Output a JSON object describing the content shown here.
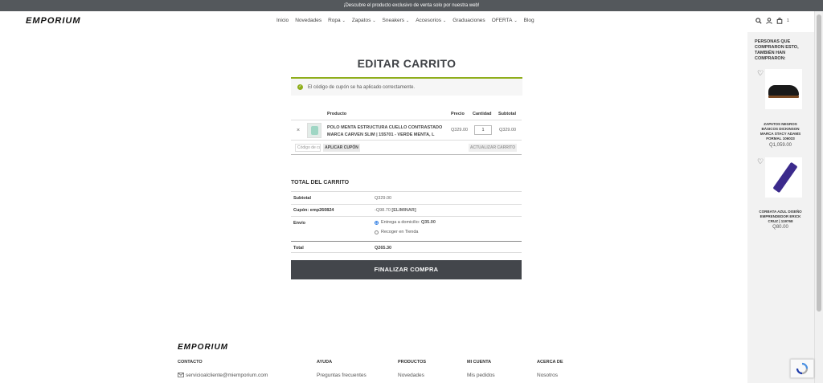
{
  "topbar": {
    "text": "¡Descubre el producto exclusivo de venta solo por nuestra web!"
  },
  "brand": {
    "logo": "EMPORIUM",
    "accent": "#8fae1b",
    "dark": "#43464b"
  },
  "nav": {
    "items": [
      {
        "label": "Inicio",
        "dropdown": false
      },
      {
        "label": "Novedades",
        "dropdown": false
      },
      {
        "label": "Ropa",
        "dropdown": true
      },
      {
        "label": "Zapatos",
        "dropdown": true
      },
      {
        "label": "Sneakers",
        "dropdown": true
      },
      {
        "label": "Accesorios",
        "dropdown": true
      },
      {
        "label": "Graduaciones",
        "dropdown": false
      },
      {
        "label": "OFERTA",
        "dropdown": true
      },
      {
        "label": "Blog",
        "dropdown": false
      }
    ],
    "cart_count": "1"
  },
  "page": {
    "title": "EDITAR CARRITO"
  },
  "notice": {
    "text": "El código de cupón se ha aplicado correctamente."
  },
  "cart": {
    "headers": {
      "product": "Producto",
      "price": "Precio",
      "qty": "Cantidad",
      "subtotal": "Subtotal"
    },
    "items": [
      {
        "remove": "×",
        "name": "POLO MENTA ESTRUCTURA CUELLO CONTRASTADO MARCA CARVEN SLIM | 155701 - VERDE MENTA, L",
        "price": "Q329.00",
        "qty": "1",
        "subtotal": "Q329.00"
      }
    ],
    "coupon_placeholder": "Código de cupón",
    "apply_label": "APLICAR CUPÓN",
    "update_label": "ACTUALIZAR CARRITO"
  },
  "totals": {
    "title": "TOTAL DEL CARRITO",
    "subtotal_label": "Subtotal",
    "subtotal_value": "Q329.00",
    "coupon_label": "Cupón: emp260824",
    "coupon_value": "-Q98.70",
    "coupon_remove": "[ELIMINAR]",
    "shipping_label": "Envío",
    "shipping_options": [
      {
        "label": "Entrega a domicilio:",
        "price": "Q35.00",
        "selected": true
      },
      {
        "label": "Recoger en Tienda",
        "price": "",
        "selected": false
      }
    ],
    "total_label": "Total",
    "total_value": "Q265.30",
    "checkout_label": "FINALIZAR COMPRA"
  },
  "footer": {
    "logo": "EMPORIUM",
    "columns": [
      {
        "heading": "CONTACTO",
        "link": "servicioalcliente@miemporium.com"
      },
      {
        "heading": "AYUDA",
        "link": "Preguntas frecuentes"
      },
      {
        "heading": "PRODUCTOS",
        "link": "Novedades"
      },
      {
        "heading": "MI CUENTA",
        "link": "Mis pedidos"
      },
      {
        "heading": "ACERCA DE",
        "link": "Nosotros"
      }
    ]
  },
  "sidebar": {
    "title": "PERSONAS QUE COMPRARON ESTO, TAMBIÉN HAN COMPRARON:",
    "products": [
      {
        "name": "ZAPATOS NEGROS BÁSICOS DICKINSON MARCA STACY ADAMS FORMAL 106033",
        "price": "Q1,059.00"
      },
      {
        "name": "CORBATA AZUL DISEÑO EMPRENDEDOR ERICK CRUZ | 119768",
        "price": "Q80.00"
      }
    ]
  }
}
